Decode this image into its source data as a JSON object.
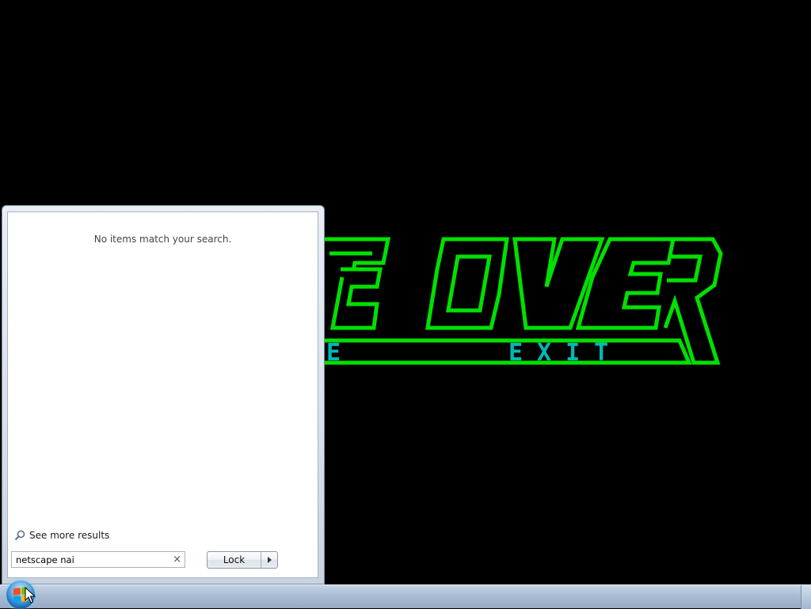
{
  "game_screen": {
    "title_fragment": "E OVER",
    "menu_left": "E",
    "menu_right": "EXIT",
    "colors": {
      "outline": "#00e000",
      "menu_text": "#00b8b8",
      "background": "#000000"
    }
  },
  "start_menu": {
    "no_results_text": "No items match your search.",
    "see_more_label": "See more results",
    "search": {
      "value": "netscape nai",
      "clear_glyph": "×"
    },
    "lock_label": "Lock"
  },
  "icons": {
    "search": "search-icon",
    "start": "windows-start-orb-icon",
    "arrow": "chevron-right-icon"
  }
}
